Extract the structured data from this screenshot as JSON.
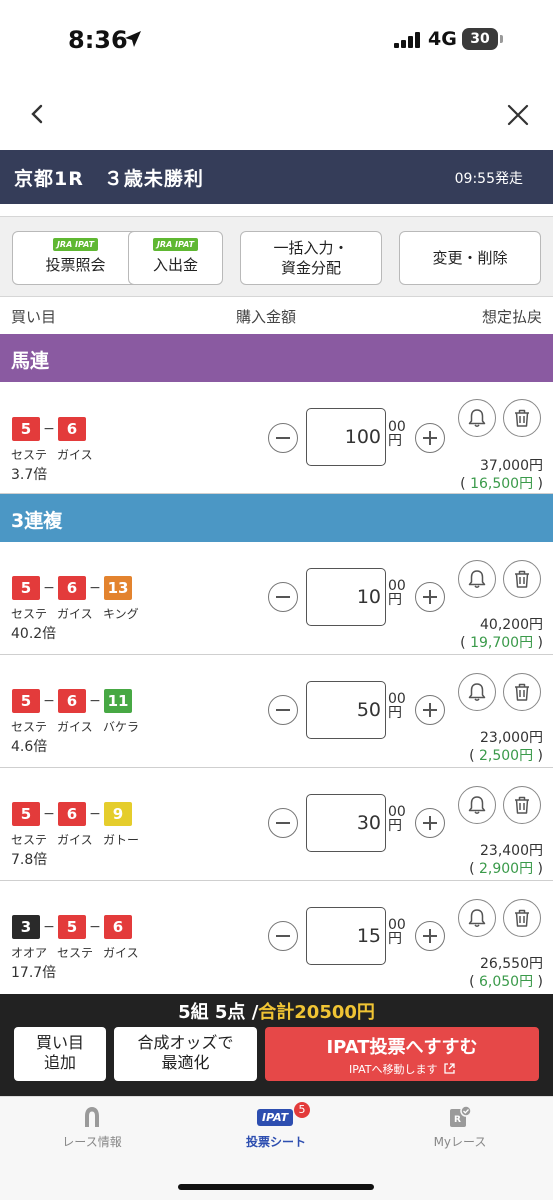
{
  "status_bar": {
    "time": "8:36",
    "network": "4G",
    "battery": "30"
  },
  "race": {
    "title": "京都1R　３歳未勝利",
    "post_time": "09:55発走"
  },
  "toolbar": {
    "badge": "JRA IPAT",
    "vote_inquiry": "投票照会",
    "deposit": "入出金",
    "bulk_line1": "一括入力・",
    "bulk_line2": "資金分配",
    "edit_delete": "変更・削除"
  },
  "columns": {
    "bet": "買い目",
    "amount": "購入金額",
    "payout": "想定払戻"
  },
  "bet_types": {
    "umaren": "馬連",
    "sanrenpuku": "3連複"
  },
  "unit": {
    "hundreds": "00",
    "yen": "円"
  },
  "bets": [
    {
      "nums": [
        "5",
        "6"
      ],
      "names": [
        "セステ",
        "ガイス"
      ],
      "odds": "3.7倍",
      "amount": "100",
      "payout": "37,000円",
      "profit": "16,500円"
    },
    {
      "nums": [
        "5",
        "6",
        "13"
      ],
      "names": [
        "セステ",
        "ガイス",
        "キング"
      ],
      "odds": "40.2倍",
      "amount": "10",
      "payout": "40,200円",
      "profit": "19,700円"
    },
    {
      "nums": [
        "5",
        "6",
        "11"
      ],
      "names": [
        "セステ",
        "ガイス",
        "バケラ"
      ],
      "odds": "4.6倍",
      "amount": "50",
      "payout": "23,000円",
      "profit": "2,500円"
    },
    {
      "nums": [
        "5",
        "6",
        "9"
      ],
      "names": [
        "セステ",
        "ガイス",
        "ガトー"
      ],
      "odds": "7.8倍",
      "amount": "30",
      "payout": "23,400円",
      "profit": "2,900円"
    },
    {
      "nums": [
        "3",
        "5",
        "6"
      ],
      "names": [
        "オオア",
        "セステ",
        "ガイス"
      ],
      "odds": "17.7倍",
      "amount": "15",
      "payout": "26,550円",
      "profit": "6,050円"
    }
  ],
  "summary": {
    "count": "5組 5点 /",
    "total": "合計20500円",
    "add_bet_line1": "買い目",
    "add_bet_line2": "追加",
    "optimize_line1": "合成オッズで",
    "optimize_line2": "最適化",
    "ipat_main": "IPAT投票へすすむ",
    "ipat_sub": "IPATへ移動します"
  },
  "tabs": {
    "race_info": "レース情報",
    "vote_sheet": "投票シート",
    "my_race": "Myレース",
    "ipat_label": "IPAT",
    "badge_count": "5"
  },
  "colors": {
    "header": "#353d59",
    "umaren": "#8a5aa1",
    "sanrenpuku": "#4b97c5",
    "primary_button": "#e64848",
    "active_tab": "#2d4eb0"
  }
}
